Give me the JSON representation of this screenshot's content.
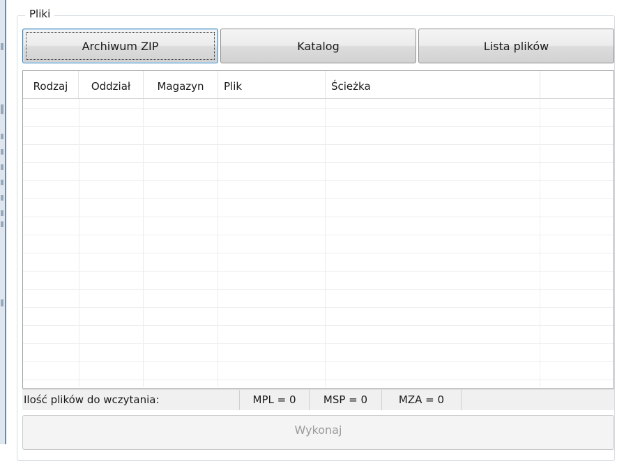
{
  "group": {
    "title": "Pliki"
  },
  "buttons": [
    {
      "label": "Archiwum ZIP",
      "focused": true
    },
    {
      "label": "Katalog",
      "focused": false
    },
    {
      "label": "Lista plików",
      "focused": false
    }
  ],
  "grid": {
    "columns": [
      "Rodzaj",
      "Oddział",
      "Magazyn",
      "Plik",
      "Ścieżka",
      ""
    ],
    "rows": []
  },
  "status": {
    "files_label": "Ilość plików do wczytania:",
    "mpl": "MPL = 0",
    "msp": "MSP = 0",
    "mza": "MZA = 0"
  },
  "action": {
    "label": "Wykonaj",
    "enabled": false
  }
}
